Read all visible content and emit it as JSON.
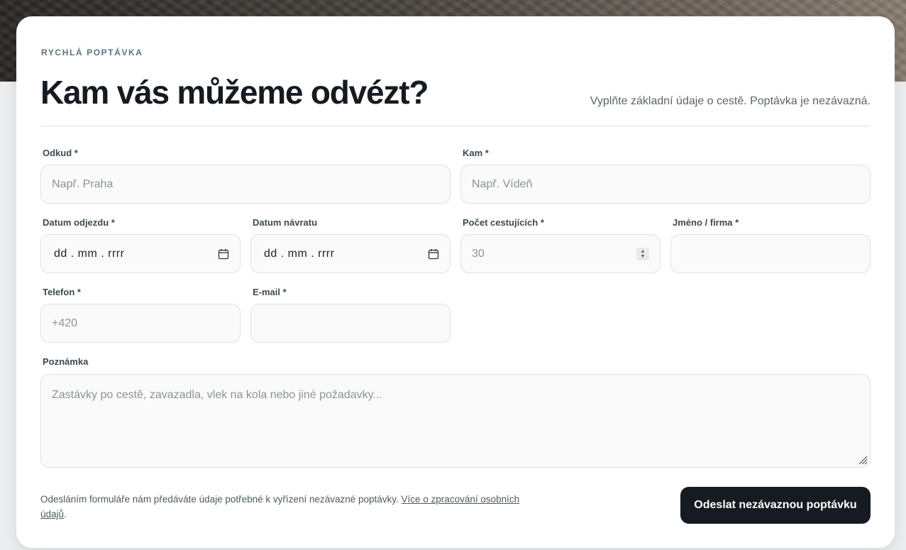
{
  "header": {
    "eyebrow": "RYCHLÁ POPTÁVKA",
    "title": "Kam vás můžeme odvézt?",
    "subtitle": "Vyplňte základní údaje o cestě. Poptávka je nezávazná."
  },
  "form": {
    "from": {
      "label": "Odkud *",
      "placeholder": "Např. Praha"
    },
    "to": {
      "label": "Kam *",
      "placeholder": "Např. Vídeň"
    },
    "departure_date": {
      "label": "Datum odjezdu *",
      "value": "dd . mm . rrrr",
      "icon": "calendar-icon"
    },
    "return_date": {
      "label": "Datum návratu",
      "value": "dd . mm . rrrr",
      "icon": "calendar-icon"
    },
    "passengers": {
      "label": "Počet cestujících *",
      "placeholder": "30"
    },
    "name": {
      "label": "Jméno / firma *",
      "placeholder": ""
    },
    "phone": {
      "label": "Telefon *",
      "placeholder": "+420"
    },
    "email": {
      "label": "E-mail *",
      "placeholder": ""
    },
    "note": {
      "label": "Poznámka",
      "placeholder": "Zastávky po cestě, zavazadla, vlek na kola nebo jiné požadavky..."
    }
  },
  "footer": {
    "consent_text": "Odesláním formuláře nám předáváte údaje potřebné k vyřízení nezávazné poptávky. ",
    "privacy_link": "Více o zpracování osobních údajů",
    "consent_end": ".",
    "submit_label": "Odeslat nezávaznou poptávku"
  },
  "colors": {
    "button_bg": "#151b20",
    "eyebrow": "#5a7380",
    "field_border": "#dde2e4"
  }
}
